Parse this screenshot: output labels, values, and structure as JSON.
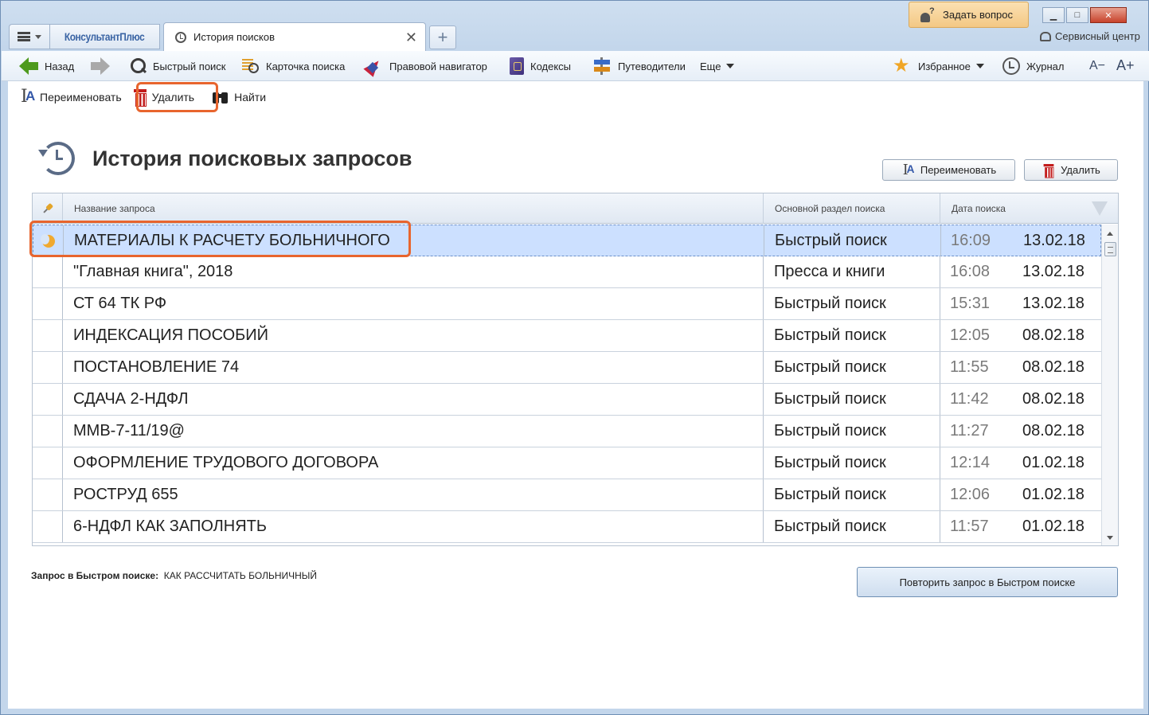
{
  "tabs": {
    "brand": "КонсультантПлюс",
    "active_title": "История поисков",
    "close": "✕",
    "new_tab": "+"
  },
  "top_right": {
    "ask_label": "Задать вопрос",
    "service_center": "Сервисный центр",
    "minimize": "▁",
    "maximize": "□",
    "close": "✕"
  },
  "toolbar": {
    "back": "Назад",
    "quick_search": "Быстрый поиск",
    "search_card": "Карточка поиска",
    "legal_navigator": "Правовой навигатор",
    "codexes": "Кодексы",
    "guides": "Путеводители",
    "more": "Еще",
    "favorites": "Избранное",
    "journal": "Журнал",
    "font_smaller": "A−",
    "font_larger": "A+"
  },
  "subbar": {
    "rename": "Переименовать",
    "delete": "Удалить",
    "find": "Найти"
  },
  "page": {
    "title": "История поисковых запросов",
    "rename_btn": "Переименовать",
    "delete_btn": "Удалить"
  },
  "table": {
    "headers": {
      "name": "Название запроса",
      "section": "Основной раздел поиска",
      "date": "Дата поиска"
    },
    "rows": [
      {
        "name": "МАТЕРИАЛЫ К РАСЧЕТУ БОЛЬНИЧНОГО",
        "section": "Быстрый поиск",
        "time": "16:09",
        "date": "13.02.18"
      },
      {
        "name": "\"Главная книга\", 2018",
        "section": "Пресса и книги",
        "time": "16:08",
        "date": "13.02.18"
      },
      {
        "name": "СТ 64 ТК РФ",
        "section": "Быстрый поиск",
        "time": "15:31",
        "date": "13.02.18"
      },
      {
        "name": "ИНДЕКСАЦИЯ ПОСОБИЙ",
        "section": "Быстрый поиск",
        "time": "12:05",
        "date": "08.02.18"
      },
      {
        "name": "ПОСТАНОВЛЕНИЕ 74",
        "section": "Быстрый поиск",
        "time": "11:55",
        "date": "08.02.18"
      },
      {
        "name": "СДАЧА 2-НДФЛ",
        "section": "Быстрый поиск",
        "time": "11:42",
        "date": "08.02.18"
      },
      {
        "name": "ММВ-7-11/19@",
        "section": "Быстрый поиск",
        "time": "11:27",
        "date": "08.02.18"
      },
      {
        "name": "ОФОРМЛЕНИЕ ТРУДОВОГО ДОГОВОРА",
        "section": "Быстрый поиск",
        "time": "12:14",
        "date": "01.02.18"
      },
      {
        "name": "РОСТРУД 655",
        "section": "Быстрый поиск",
        "time": "12:06",
        "date": "01.02.18"
      },
      {
        "name": "6-НДФЛ КАК ЗАПОЛНЯТЬ",
        "section": "Быстрый поиск",
        "time": "11:57",
        "date": "01.02.18"
      }
    ]
  },
  "footer": {
    "query_label": "Запрос в Быстром поиске:",
    "query_value": "КАК РАССЧИТАТЬ БОЛЬНИЧНЫЙ",
    "repeat_btn": "Повторить запрос в Быстром поиске"
  },
  "colors": {
    "highlight": "#e8652e",
    "selected_row": "#cce0ff"
  }
}
